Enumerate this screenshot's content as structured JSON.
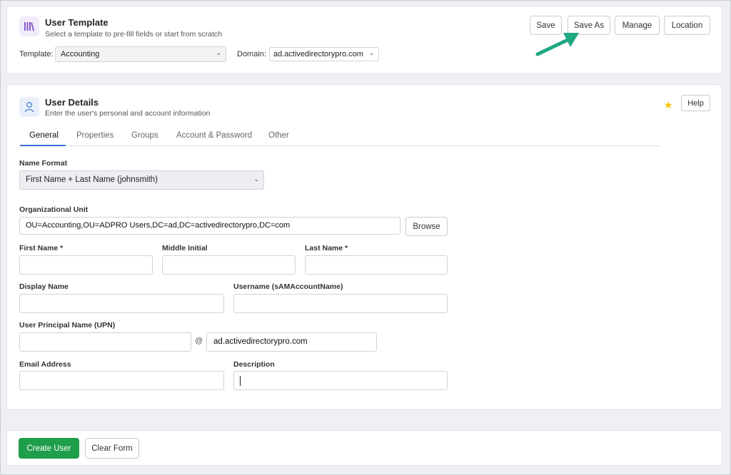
{
  "template_card": {
    "title": "User Template",
    "subtitle": "Select a template to pre-fill fields or start from scratch",
    "template_label": "Template:",
    "template_value": "Accounting",
    "domain_label": "Domain:",
    "domain_value": "ad.activedirectorypro.com",
    "buttons": {
      "save": "Save",
      "save_as": "Save As",
      "manage": "Manage",
      "location": "Location"
    }
  },
  "details_card": {
    "title": "User Details",
    "subtitle": "Enter the user's personal and account information",
    "help_label": "Help",
    "tabs": [
      "General",
      "Properties",
      "Groups",
      "Account & Password",
      "Other"
    ],
    "active_tab": "General",
    "name_format": {
      "label": "Name Format",
      "value": "First Name + Last Name (johnsmith)"
    },
    "ou": {
      "label": "Organizational Unit",
      "value": "OU=Accounting,OU=ADPRO Users,DC=ad,DC=activedirectorypro,DC=com",
      "browse_label": "Browse"
    },
    "first_name": {
      "label": "First Name *",
      "value": ""
    },
    "middle_initial": {
      "label": "Middle Initial",
      "value": ""
    },
    "last_name": {
      "label": "Last Name *",
      "value": ""
    },
    "display_name": {
      "label": "Display Name",
      "value": ""
    },
    "username": {
      "label": "Username (sAMAccountName)",
      "value": ""
    },
    "upn": {
      "label": "User Principal Name (UPN)",
      "value": "",
      "at": "@",
      "domain": "ad.activedirectorypro.com"
    },
    "email": {
      "label": "Email Address",
      "value": ""
    },
    "description": {
      "label": "Description",
      "value": ""
    }
  },
  "footer": {
    "create_label": "Create User",
    "clear_label": "Clear Form"
  },
  "colors": {
    "accent": "#3d6fd6",
    "primary_button": "#1e9d4b",
    "annotation_arrow": "#1fa882",
    "star": "#f2c200"
  },
  "icons": [
    "books-icon",
    "user-icon",
    "star-icon",
    "chevron-down-icon",
    "arrow-annotation"
  ]
}
